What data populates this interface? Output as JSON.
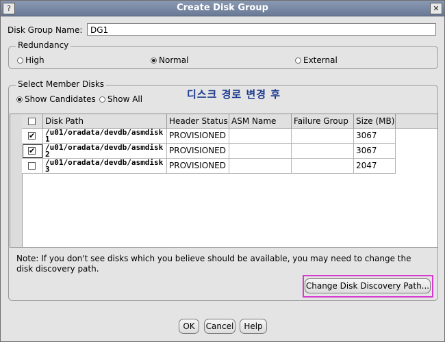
{
  "window": {
    "title": "Create Disk Group",
    "help_button": "?",
    "close_button": "✕"
  },
  "disk_group_name": {
    "label": "Disk Group Name:",
    "value": "DG1"
  },
  "redundancy": {
    "title": "Redundancy",
    "options": [
      {
        "label": "High",
        "selected": false
      },
      {
        "label": "Normal",
        "selected": true
      },
      {
        "label": "External",
        "selected": false
      }
    ]
  },
  "member_disks": {
    "title": "Select Member Disks",
    "show_candidates": "Show Candidates",
    "show_all": "Show All",
    "annotation": "디스크 경로 변경 후",
    "columns": [
      "",
      "Disk Path",
      "Header Status",
      "ASM Name",
      "Failure Group",
      "Size (MB)"
    ],
    "rows": [
      {
        "checked": true,
        "path": "/u01/oradata/devdb/asmdisk1",
        "header_status": "PROVISIONED",
        "asm_name": "",
        "failure_group": "",
        "size": "3067"
      },
      {
        "checked": true,
        "path": "/u01/oradata/devdb/asmdisk2",
        "header_status": "PROVISIONED",
        "asm_name": "",
        "failure_group": "",
        "size": "3067"
      },
      {
        "checked": false,
        "path": "/u01/oradata/devdb/asmdisk3",
        "header_status": "PROVISIONED",
        "asm_name": "",
        "failure_group": "",
        "size": "2047"
      }
    ]
  },
  "note": "Note: If you don't see disks which you believe should be available, you may need to change the disk discovery path.",
  "buttons": {
    "change_path": "Change Disk Discovery Path...",
    "ok": "OK",
    "cancel": "Cancel",
    "help": "Help"
  },
  "colors": {
    "highlight": "#d63ad0",
    "annotation": "#1c3a8e",
    "titlebar": "#7a8aa6"
  }
}
